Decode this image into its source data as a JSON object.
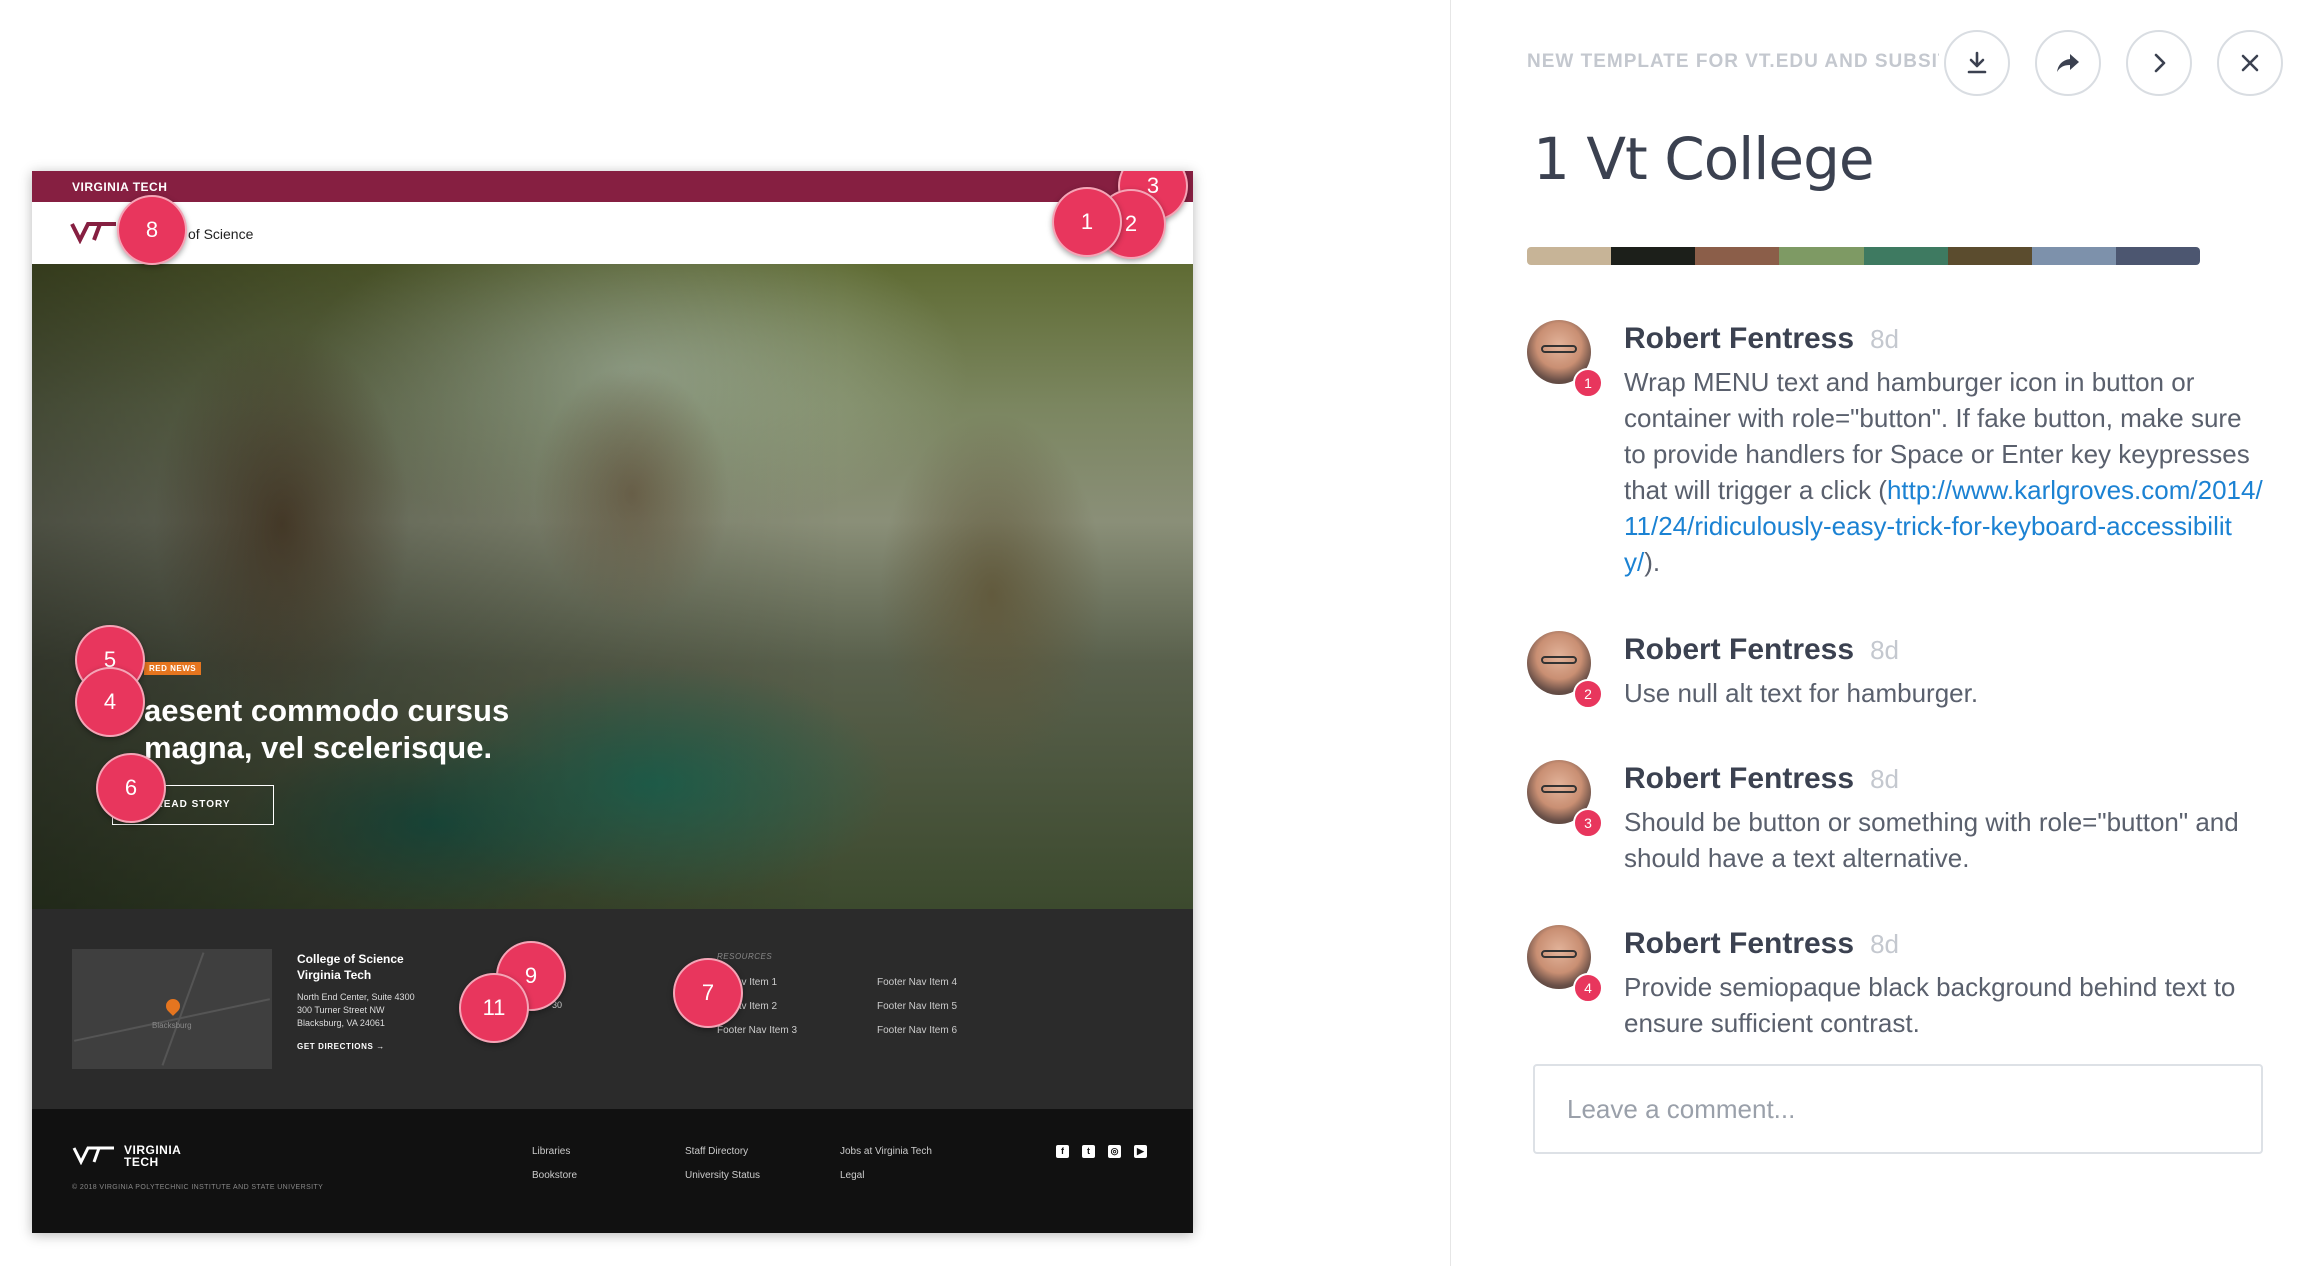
{
  "preview": {
    "topbar_label": "VIRGINIA TECH",
    "college": "of Science",
    "hero": {
      "badge": "RED NEWS",
      "headline": "aesent commodo cursus magna, vel scelerisque.",
      "cta": "READ STORY"
    },
    "footer": {
      "map_label": "Blacksburg",
      "title_lines": [
        "College of Science",
        "Virginia Tech"
      ],
      "address_lines": [
        "North End Center, Suite 4300",
        "300 Turner Street NW",
        "Blacksburg, VA 24061"
      ],
      "directions": "GET DIRECTIONS",
      "contact_fragments": [
        "2",
        "30"
      ],
      "resources_heading": "RESOURCES",
      "nav_col1": [
        "er Nav Item 1",
        "er Nav Item 2",
        "Footer Nav Item 3"
      ],
      "nav_col2": [
        "Footer Nav Item 4",
        "Footer Nav Item 5",
        "Footer Nav Item 6"
      ]
    },
    "bottom": {
      "wordmark": [
        "VIRGINIA",
        "TECH"
      ],
      "copyright": "© 2018 VIRGINIA POLYTECHNIC INSTITUTE AND STATE UNIVERSITY",
      "links": [
        "Libraries",
        "Bookstore",
        "Staff Directory",
        "University Status",
        "Jobs at Virginia Tech",
        "Legal"
      ],
      "social_icons": [
        "facebook-icon",
        "twitter-icon",
        "instagram-icon",
        "youtube-icon"
      ]
    },
    "markers": [
      "1",
      "2",
      "3",
      "4",
      "5",
      "6",
      "7",
      "8",
      "9",
      "11"
    ]
  },
  "sidebar": {
    "title": "NEW TEMPLATE FOR VT.EDU AND SUBSITES",
    "toolbar_icons": [
      "download-icon",
      "share-icon",
      "next-icon",
      "close-icon"
    ],
    "heading": "1 Vt College",
    "palette": [
      "#c7b497",
      "#1c1f1a",
      "#8b5e49",
      "#7e9a64",
      "#3e7a61",
      "#5b4c2e",
      "#7d91ab",
      "#4c5670"
    ],
    "comments": [
      {
        "num": "1",
        "author": "Robert Fentress",
        "time": "8d",
        "text": "Wrap MENU text and hamburger icon in button or container with role=\"button\". If fake button, make sure to provide handlers for Space or Enter key keypresses that will trigger a click (",
        "link": "http://www.karlgroves.com/2014/11/24/ridiculously-easy-trick-for-keyboard-accessibility/",
        "after": ")."
      },
      {
        "num": "2",
        "author": "Robert Fentress",
        "time": "8d",
        "text": "Use null alt text for hamburger."
      },
      {
        "num": "3",
        "author": "Robert Fentress",
        "time": "8d",
        "text": "Should be button or something with role=\"button\" and should have a text alternative."
      },
      {
        "num": "4",
        "author": "Robert Fentress",
        "time": "8d",
        "text": "Provide semiopaque black background behind text to ensure sufficient contrast."
      }
    ],
    "comment_placeholder": "Leave a comment..."
  }
}
